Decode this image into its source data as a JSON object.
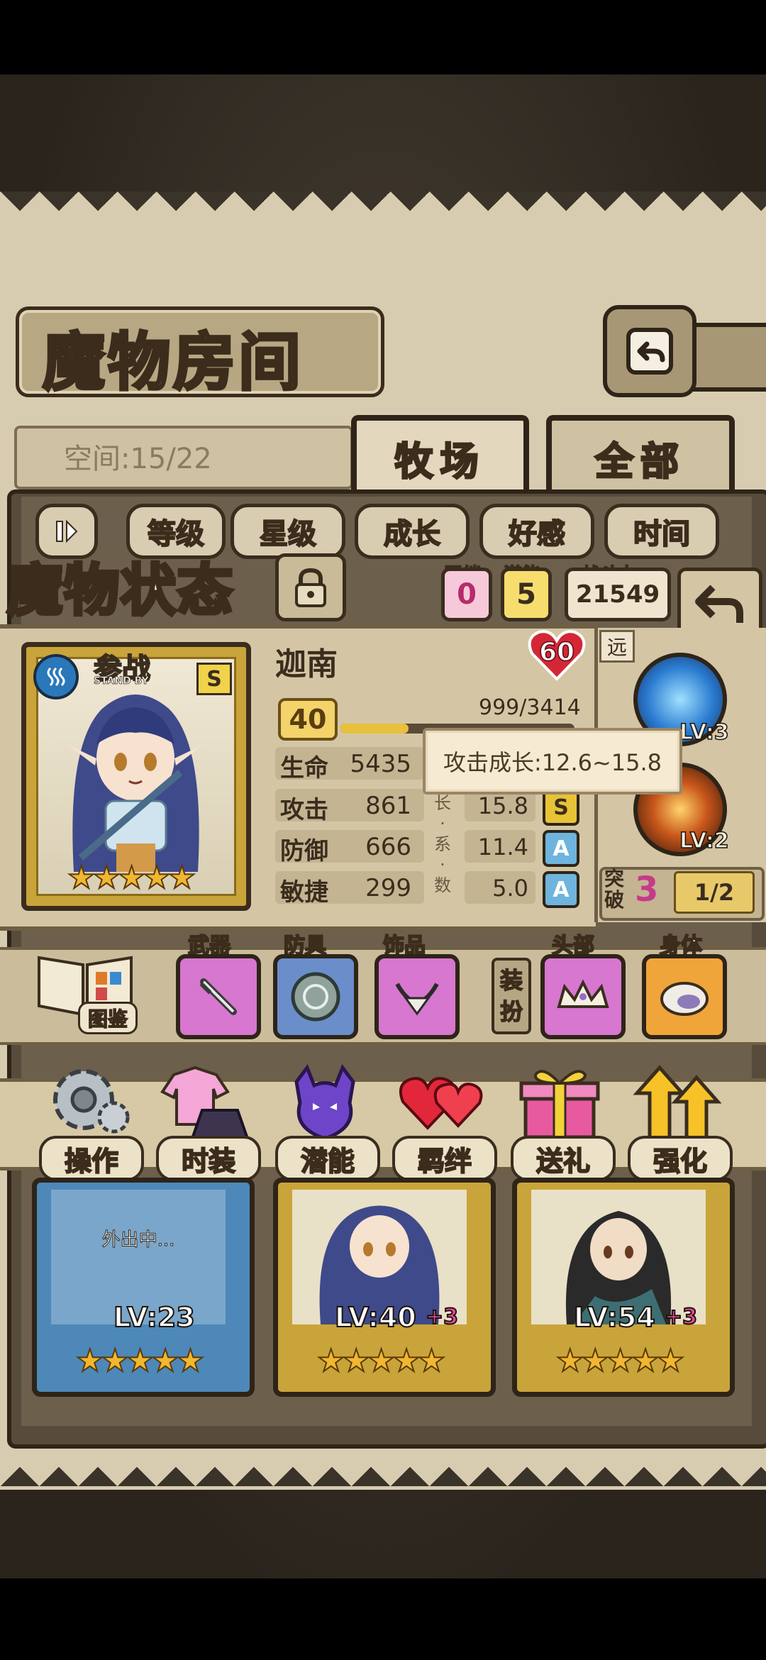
{
  "page": {
    "title": "魔物房间"
  },
  "header": {
    "space_label": "空间:15/22"
  },
  "tabs": [
    {
      "label": "牧场"
    },
    {
      "label": "全部"
    }
  ],
  "sort_buttons": [
    {
      "label": "等级"
    },
    {
      "label": "星级"
    },
    {
      "label": "成长"
    },
    {
      "label": "好感"
    },
    {
      "label": "时间"
    }
  ],
  "status": {
    "section_title": "魔物状态",
    "bond_label": "羁绊",
    "bond_value": "0",
    "potential_label": "潜能",
    "potential_value": "5",
    "power_label": "战斗力",
    "power_value": "21549"
  },
  "monster": {
    "name": "迦南",
    "rank_number": "60",
    "card_badge": "参战",
    "card_badge_sub": "STAND BY",
    "grade": "S",
    "level": "40",
    "xp_text": "999/3414",
    "xp_fraction": 0.29,
    "stars": "★★★★★",
    "stats": [
      {
        "label": "生命",
        "value": "5435",
        "growth": "",
        "grade": ""
      },
      {
        "label": "攻击",
        "value": "861",
        "growth": "15.8",
        "grade": "S"
      },
      {
        "label": "防御",
        "value": "666",
        "growth": "11.4",
        "grade": "A"
      },
      {
        "label": "敏捷",
        "value": "299",
        "growth": "5.0",
        "grade": "A"
      }
    ],
    "growth_vertical": [
      "长",
      "·",
      "系",
      "·",
      "数"
    ],
    "tooltip": "攻击成长:12.6~15.8"
  },
  "skills": {
    "range_tag": "远",
    "items": [
      {
        "level": "LV:3"
      },
      {
        "level": "LV:2"
      }
    ],
    "break_label_1": "突",
    "break_label_2": "破",
    "break_value": "3",
    "break_progress": "1/2"
  },
  "equipment": {
    "codex_label": "图鉴",
    "slots": [
      {
        "label": "武器"
      },
      {
        "label": "防具"
      },
      {
        "label": "饰品"
      },
      {
        "label": "头部"
      },
      {
        "label": "身体"
      }
    ],
    "dress_label_1": "装",
    "dress_label_2": "扮"
  },
  "actions": [
    {
      "label": "操作"
    },
    {
      "label": "时装"
    },
    {
      "label": "潜能"
    },
    {
      "label": "羁绊"
    },
    {
      "label": "送礼"
    },
    {
      "label": "强化"
    }
  ],
  "monster_cards": [
    {
      "level": "LV:23",
      "plus": "",
      "status": "外出中...",
      "stars": "★★★★★"
    },
    {
      "level": "LV:40",
      "plus": "+3",
      "status": "",
      "stars": "★★★★★"
    },
    {
      "level": "LV:54",
      "plus": "+3",
      "status": "",
      "stars": "★★★★★"
    }
  ],
  "colors": {
    "accent_gold": "#e9c03c",
    "grade_s": "#e8c335",
    "grade_a": "#6fb4dc",
    "bond_pink": "#f6c9da"
  }
}
